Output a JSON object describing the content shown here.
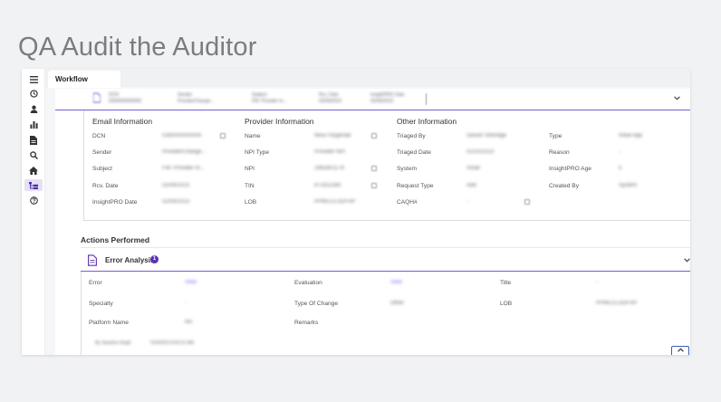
{
  "page_title": "QA Audit the Auditor",
  "tabs": [
    {
      "label": "Workflow"
    }
  ],
  "doc_header": {
    "columns": [
      {
        "label": "DCN",
        "value": "0260000000000"
      },
      {
        "label": "Sender",
        "value": "ProviderChange..."
      },
      {
        "label": "Subject",
        "value": "FW: Provider In..."
      },
      {
        "label": "Rcv. Date",
        "value": "02/09/2023"
      },
      {
        "label": "InsightPRO Date",
        "value": "02/09/2023"
      }
    ]
  },
  "email_info": {
    "heading": "Email Information",
    "rows": [
      {
        "label": "DCN",
        "value": "0260000000000"
      },
      {
        "label": "Sender",
        "value": "ProviderChange..."
      },
      {
        "label": "Subject",
        "value": "FW: Provider In..."
      },
      {
        "label": "Rcv. Date",
        "value": "02/09/2023"
      },
      {
        "label": "InsightPRO Date",
        "value": "02/09/2023"
      }
    ]
  },
  "provider_info": {
    "heading": "Provider Information",
    "rows": [
      {
        "label": "Name",
        "value": "Nina Fitzgerald"
      },
      {
        "label": "NPI Type",
        "value": "Provider NPI"
      },
      {
        "label": "NPI",
        "value": "1982801178"
      },
      {
        "label": "TIN",
        "value": "871811560"
      },
      {
        "label": "LOB",
        "value": "PPMCCLSDFHP"
      }
    ]
  },
  "other_info": {
    "heading": "Other Information",
    "rows_left": [
      {
        "label": "Triaged By",
        "value": "Sanish Shendge"
      },
      {
        "label": "Triaged Date",
        "value": "02/10/2023"
      },
      {
        "label": "System",
        "value": "Vistar"
      },
      {
        "label": "Request Type",
        "value": "Add"
      },
      {
        "label": "CAQH#",
        "value": "-"
      }
    ],
    "rows_right": [
      {
        "label": "Type",
        "value": "Initial App"
      },
      {
        "label": "Reason",
        "value": "-"
      },
      {
        "label": "InsightPRO Age",
        "value": "5"
      },
      {
        "label": "Created By",
        "value": "System"
      }
    ]
  },
  "actions": {
    "heading": "Actions Performed",
    "error_analysis": {
      "title": "Error Analysis",
      "badge": "1",
      "fields": [
        {
          "label": "Error",
          "value": "View",
          "link": true
        },
        {
          "label": "Evaluation",
          "value": "View",
          "link": true
        },
        {
          "label": "Title",
          "value": "-"
        },
        {
          "label": "Specialty",
          "value": "-"
        },
        {
          "label": "Type Of Change",
          "value": "Other"
        },
        {
          "label": "LOB",
          "value": "PPMCCLSDFHP"
        },
        {
          "label": "Platform Name",
          "value": "NA"
        },
        {
          "label": "Remarks",
          "value": ""
        }
      ],
      "footer_user": "By Sanisha Singh",
      "footer_time": "7/24/2023 8:50:21 AM"
    }
  },
  "rail_icons": [
    "menu-icon",
    "history-icon",
    "user-icon",
    "bar-chart-icon",
    "document-icon",
    "search-icon",
    "home-icon",
    "workflow-icon",
    "help-icon"
  ],
  "colors": {
    "accent": "#7b5bd6",
    "badge": "#5b2fb2",
    "link": "#6b6bff"
  }
}
